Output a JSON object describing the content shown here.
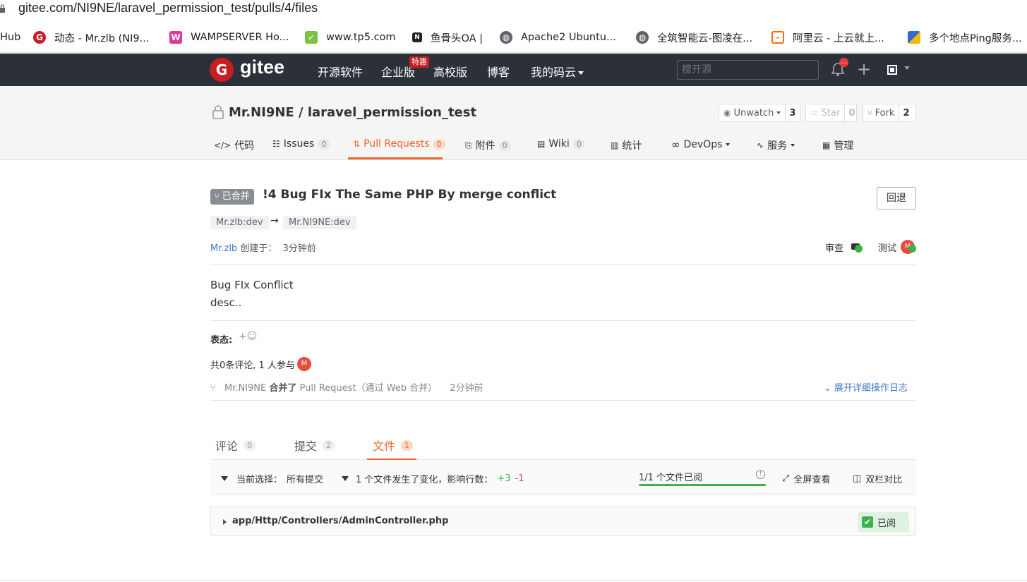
{
  "browser": {
    "url": "gitee.com/NI9NE/laravel_permission_test/pulls/4/files",
    "bookmarks": [
      {
        "label": "Hub",
        "icon": "none"
      },
      {
        "label": "动态 - Mr.zlb (NI9...",
        "icon": "gitee-icon"
      },
      {
        "label": "WAMPSERVER Ho...",
        "icon": "wamp-icon"
      },
      {
        "label": "www.tp5.com",
        "icon": "tp5-icon"
      },
      {
        "label": "鱼骨头OA |",
        "icon": "oa-icon"
      },
      {
        "label": "Apache2 Ubuntu...",
        "icon": "globe-icon"
      },
      {
        "label": "全筑智能云-图凌在...",
        "icon": "globe-icon"
      },
      {
        "label": "阿里云 - 上云就上...",
        "icon": "aliyun-icon"
      },
      {
        "label": "多个地点Ping服务...",
        "icon": "ping-icon"
      }
    ]
  },
  "header": {
    "brand": "gitee",
    "nav": [
      "开源软件",
      "企业版",
      "高校版",
      "博客",
      "我的码云"
    ],
    "enterprise_badge": "特惠",
    "search_placeholder": "搜开源",
    "notification_badge": "..."
  },
  "repo": {
    "title": "Mr.NI9NE / laravel_permission_test",
    "watch": {
      "label": "Unwatch",
      "count": "3"
    },
    "star": {
      "label": "Star",
      "count": "0"
    },
    "fork": {
      "label": "Fork",
      "count": "2"
    },
    "tabs": [
      {
        "label": "代码",
        "count": ""
      },
      {
        "label": "Issues",
        "count": "0"
      },
      {
        "label": "Pull Requests",
        "count": "0"
      },
      {
        "label": "附件",
        "count": "0"
      },
      {
        "label": "Wiki",
        "count": "0"
      },
      {
        "label": "统计",
        "count": ""
      },
      {
        "label": "DevOps",
        "count": ""
      },
      {
        "label": "服务",
        "count": ""
      },
      {
        "label": "管理",
        "count": ""
      }
    ]
  },
  "pr": {
    "status": "已合并",
    "title": "!4 Bug FIx The Same PHP By merge conflict",
    "revert_label": "回退",
    "source_branch": "Mr.zlb:dev",
    "arrow": "→",
    "target_branch": "Mr.NI9NE:dev",
    "author": "Mr.zlb",
    "created_label": "创建于：",
    "created_time": "3分钟前",
    "reviewer_label": "审查",
    "tester_label": "测试",
    "tester_avatar": "M",
    "description_line1": "Bug FIx Conflict",
    "description_line2": "desc..",
    "reaction_label": "表态:",
    "reaction_add": "+☺",
    "comment_summary": "共0条评论, 1 人参与",
    "participant_avatar": "M",
    "log_user": "Mr.NI9NE",
    "log_action": "合并了",
    "log_text": "Pull Request（通过 Web 合并）",
    "log_time": "2分钟前",
    "expand_log": "展开详细操作日志"
  },
  "subtabs": [
    {
      "label": "评论",
      "count": "0"
    },
    {
      "label": "提交",
      "count": "2"
    },
    {
      "label": "文件",
      "count": "1"
    }
  ],
  "files_bar": {
    "current_selection_label": "当前选择：",
    "current_selection_value": "所有提交",
    "change_summary": "1 个文件发生了变化，影响行数：",
    "additions": "+3",
    "deletions": "-1",
    "viewed_summary": "1/1 个文件已阅",
    "viewed_progress": 1.0,
    "fullscreen_label": "全屏查看",
    "split_label": "双栏对比"
  },
  "file": {
    "path": "app/Http/Controllers/AdminController.php",
    "viewed_label": "已阅"
  },
  "colors": {
    "header_bg": "#2c3038",
    "accent_orange": "#f0642a",
    "brand_red": "#c71d23",
    "success_green": "#3cb34a",
    "link_blue": "#3a78c8"
  }
}
